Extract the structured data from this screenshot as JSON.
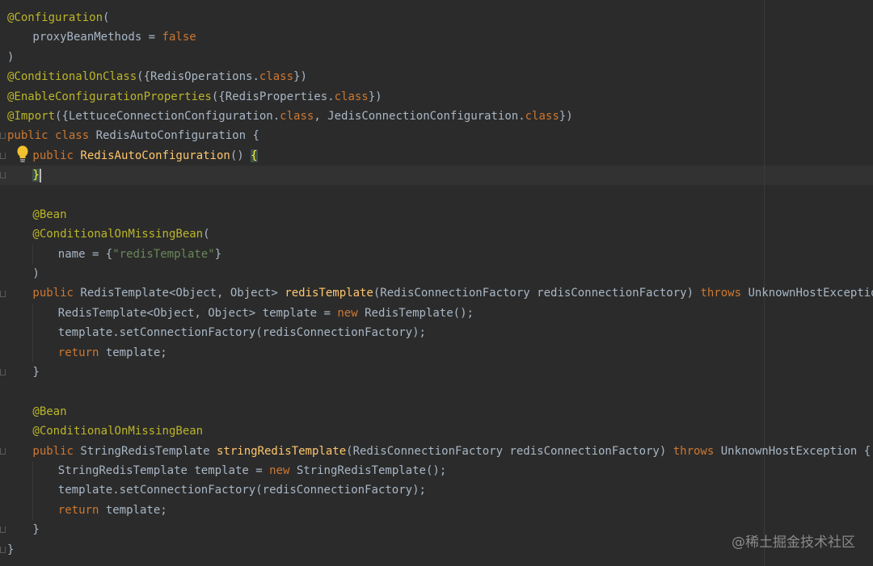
{
  "editor": {
    "code": [
      {
        "i": 0,
        "t": [
          [
            "ann",
            "@Configuration"
          ],
          [
            "id",
            "("
          ]
        ]
      },
      {
        "i": 1,
        "t": [
          [
            "id",
            "proxyBeanMethods = "
          ],
          [
            "kw",
            "false"
          ]
        ]
      },
      {
        "i": 0,
        "t": [
          [
            "id",
            ")"
          ]
        ]
      },
      {
        "i": 0,
        "t": [
          [
            "ann",
            "@ConditionalOnClass"
          ],
          [
            "id",
            "({RedisOperations."
          ],
          [
            "kw",
            "class"
          ],
          [
            "id",
            "})"
          ]
        ]
      },
      {
        "i": 0,
        "t": [
          [
            "ann",
            "@EnableConfigurationProperties"
          ],
          [
            "id",
            "({RedisProperties."
          ],
          [
            "kw",
            "class"
          ],
          [
            "id",
            "})"
          ]
        ]
      },
      {
        "i": 0,
        "t": [
          [
            "ann",
            "@Import"
          ],
          [
            "id",
            "({LettuceConnectionConfiguration."
          ],
          [
            "kw",
            "class"
          ],
          [
            "id",
            ", JedisConnectionConfiguration."
          ],
          [
            "kw",
            "class"
          ],
          [
            "id",
            "})"
          ]
        ]
      },
      {
        "i": 0,
        "t": [
          [
            "kw",
            "public class "
          ],
          [
            "id",
            "RedisAutoConfiguration {"
          ]
        ]
      },
      {
        "i": 1,
        "t": [
          [
            "kw",
            "public "
          ],
          [
            "fn",
            "RedisAutoConfiguration"
          ],
          [
            "id",
            "() "
          ],
          [
            "hl",
            "{"
          ]
        ]
      },
      {
        "i": 1,
        "t": [
          [
            "hl",
            "}"
          ],
          [
            "caret",
            ""
          ]
        ]
      },
      {
        "i": 0,
        "t": []
      },
      {
        "i": 1,
        "t": [
          [
            "ann",
            "@Bean"
          ]
        ]
      },
      {
        "i": 1,
        "t": [
          [
            "ann",
            "@ConditionalOnMissingBean"
          ],
          [
            "id",
            "("
          ]
        ]
      },
      {
        "i": 2,
        "t": [
          [
            "id",
            "name = {"
          ],
          [
            "str",
            "\"redisTemplate\""
          ],
          [
            "id",
            "}"
          ]
        ]
      },
      {
        "i": 1,
        "t": [
          [
            "id",
            ")"
          ]
        ]
      },
      {
        "i": 1,
        "t": [
          [
            "kw",
            "public "
          ],
          [
            "id",
            "RedisTemplate<Object, Object> "
          ],
          [
            "fn",
            "redisTemplate"
          ],
          [
            "id",
            "(RedisConnectionFactory redisConnectionFactory) "
          ],
          [
            "kw",
            "throws "
          ],
          [
            "id",
            "UnknownHostException {"
          ]
        ]
      },
      {
        "i": 2,
        "t": [
          [
            "id",
            "RedisTemplate<Object, Object> template = "
          ],
          [
            "kw",
            "new "
          ],
          [
            "id",
            "RedisTemplate();"
          ]
        ]
      },
      {
        "i": 2,
        "t": [
          [
            "id",
            "template.setConnectionFactory(redisConnectionFactory);"
          ]
        ]
      },
      {
        "i": 2,
        "t": [
          [
            "kw",
            "return "
          ],
          [
            "id",
            "template;"
          ]
        ]
      },
      {
        "i": 1,
        "t": [
          [
            "id",
            "}"
          ]
        ]
      },
      {
        "i": 0,
        "t": []
      },
      {
        "i": 1,
        "t": [
          [
            "ann",
            "@Bean"
          ]
        ]
      },
      {
        "i": 1,
        "t": [
          [
            "ann",
            "@ConditionalOnMissingBean"
          ]
        ]
      },
      {
        "i": 1,
        "t": [
          [
            "kw",
            "public "
          ],
          [
            "id",
            "StringRedisTemplate "
          ],
          [
            "fn",
            "stringRedisTemplate"
          ],
          [
            "id",
            "(RedisConnectionFactory redisConnectionFactory) "
          ],
          [
            "kw",
            "throws "
          ],
          [
            "id",
            "UnknownHostException {"
          ]
        ]
      },
      {
        "i": 2,
        "t": [
          [
            "id",
            "StringRedisTemplate template = "
          ],
          [
            "kw",
            "new "
          ],
          [
            "id",
            "StringRedisTemplate();"
          ]
        ]
      },
      {
        "i": 2,
        "t": [
          [
            "id",
            "template.setConnectionFactory(redisConnectionFactory);"
          ]
        ]
      },
      {
        "i": 2,
        "t": [
          [
            "kw",
            "return "
          ],
          [
            "id",
            "template;"
          ]
        ]
      },
      {
        "i": 1,
        "t": [
          [
            "id",
            "}"
          ]
        ]
      },
      {
        "i": 0,
        "t": [
          [
            "id",
            "}"
          ]
        ]
      }
    ]
  },
  "watermark": "@稀土掘金技术社区",
  "icons": {
    "bulb": "lightbulb-icon"
  },
  "colors": {
    "background": "#2b2b2b",
    "annotation": "#bbb529",
    "keyword": "#cc7832",
    "string": "#6a8759",
    "method": "#ffc66d",
    "identifier": "#a9b7c6"
  }
}
